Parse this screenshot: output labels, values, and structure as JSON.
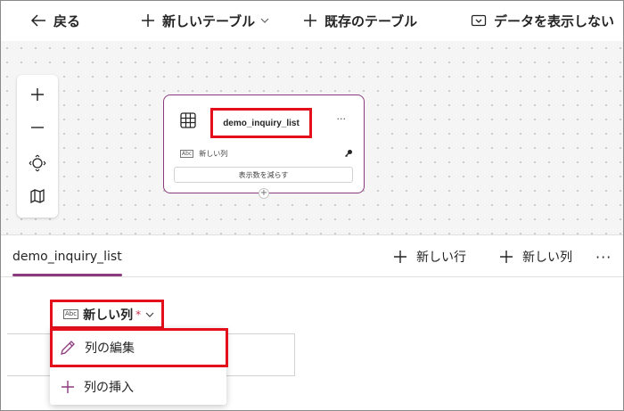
{
  "toolbar": {
    "back_label": "戻る",
    "new_table_label": "新しいテーブル",
    "existing_table_label": "既存のテーブル",
    "hide_data_label": "データを表示しない"
  },
  "canvas": {
    "tools": [
      "zoom-in",
      "zoom-out",
      "fit-view",
      "map"
    ],
    "table_card": {
      "title": "demo_inquiry_list",
      "more_label": "···",
      "column_label": "新しい列",
      "column_type_icon": "Abc",
      "reduce_button_label": "表示数を減らす",
      "add_label": "+"
    }
  },
  "grid": {
    "tab_label": "demo_inquiry_list",
    "new_row_label": "新しい行",
    "new_column_label": "新しい列",
    "more_label": "···",
    "column_header": {
      "type_icon": "Abc",
      "name": "新しい列",
      "required_mark": "*"
    }
  },
  "context_menu": {
    "items": [
      {
        "label": "列の編集",
        "icon": "pencil-icon"
      },
      {
        "label": "列の挿入",
        "icon": "plus-icon"
      }
    ]
  },
  "colors": {
    "accent": "#8c3a7e",
    "highlight": "#e3101b"
  }
}
